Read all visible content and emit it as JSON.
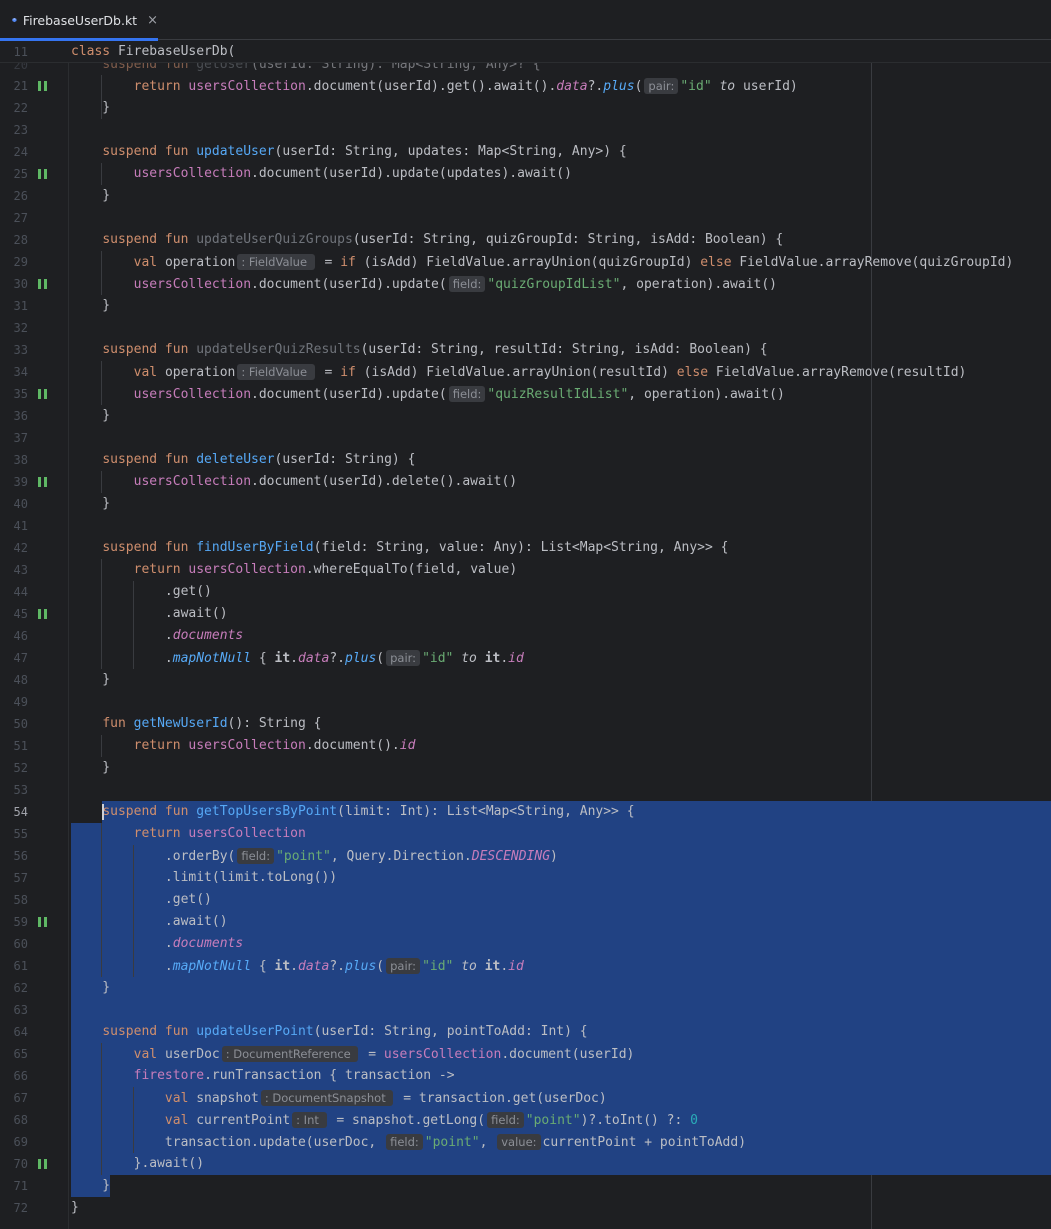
{
  "tab": {
    "filename": "FirebaseUserDb.kt",
    "close": "×"
  },
  "lines": [
    {
      "n": "11",
      "runs": [
        [
          "kw",
          "class "
        ],
        [
          "",
          "FirebaseUserDb("
        ]
      ]
    },
    {
      "n": "21",
      "g": true,
      "runs": [
        [
          "",
          "        "
        ],
        [
          "kw",
          "return "
        ],
        [
          "pr",
          "usersCollection"
        ],
        [
          "",
          ".document(userId).get().await()."
        ],
        [
          "pi",
          "data"
        ],
        [
          "",
          "?."
        ],
        [
          "ex",
          "plus"
        ],
        [
          "",
          "("
        ],
        [
          "inl",
          "pair:"
        ],
        [
          "st",
          "\"id\""
        ],
        [
          "",
          " "
        ],
        [
          "ki",
          "to"
        ],
        [
          "",
          " userId)"
        ]
      ]
    },
    {
      "n": "22",
      "runs": [
        [
          "",
          "    }"
        ]
      ]
    },
    {
      "n": "23",
      "runs": []
    },
    {
      "n": "24",
      "runs": [
        [
          "",
          "    "
        ],
        [
          "kw",
          "suspend fun "
        ],
        [
          "fn",
          "updateUser"
        ],
        [
          "",
          "(userId: String, updates: Map<String, Any>) {"
        ]
      ]
    },
    {
      "n": "25",
      "g": true,
      "runs": [
        [
          "",
          "        "
        ],
        [
          "pr",
          "usersCollection"
        ],
        [
          "",
          ".document(userId).update(updates).await()"
        ]
      ]
    },
    {
      "n": "26",
      "runs": [
        [
          "",
          "    }"
        ]
      ]
    },
    {
      "n": "27",
      "runs": []
    },
    {
      "n": "28",
      "runs": [
        [
          "",
          "    "
        ],
        [
          "kw",
          "suspend fun "
        ],
        [
          "fnu",
          "updateUserQuizGroups"
        ],
        [
          "",
          "(userId: String, quizGroupId: String, isAdd: Boolean) {"
        ]
      ]
    },
    {
      "n": "29",
      "runs": [
        [
          "",
          "        "
        ],
        [
          "kw",
          "val "
        ],
        [
          "",
          "operation"
        ],
        [
          "inl",
          ": FieldValue "
        ],
        [
          "",
          " = "
        ],
        [
          "kw",
          "if "
        ],
        [
          "",
          "(isAdd) FieldValue.arrayUnion(quizGroupId) "
        ],
        [
          "kw",
          "else "
        ],
        [
          "",
          "FieldValue.arrayRemove(quizGroupId)"
        ]
      ]
    },
    {
      "n": "30",
      "g": true,
      "runs": [
        [
          "",
          "        "
        ],
        [
          "pr",
          "usersCollection"
        ],
        [
          "",
          ".document(userId).update("
        ],
        [
          "inl",
          "field:"
        ],
        [
          "st",
          "\"quizGroupIdList\""
        ],
        [
          "",
          ", operation).await()"
        ]
      ]
    },
    {
      "n": "31",
      "runs": [
        [
          "",
          "    }"
        ]
      ]
    },
    {
      "n": "32",
      "runs": []
    },
    {
      "n": "33",
      "runs": [
        [
          "",
          "    "
        ],
        [
          "kw",
          "suspend fun "
        ],
        [
          "fnu",
          "updateUserQuizResults"
        ],
        [
          "",
          "(userId: String, resultId: String, isAdd: Boolean) {"
        ]
      ]
    },
    {
      "n": "34",
      "runs": [
        [
          "",
          "        "
        ],
        [
          "kw",
          "val "
        ],
        [
          "",
          "operation"
        ],
        [
          "inl",
          ": FieldValue "
        ],
        [
          "",
          " = "
        ],
        [
          "kw",
          "if "
        ],
        [
          "",
          "(isAdd) FieldValue.arrayUnion(resultId) "
        ],
        [
          "kw",
          "else "
        ],
        [
          "",
          "FieldValue.arrayRemove(resultId)"
        ]
      ]
    },
    {
      "n": "35",
      "g": true,
      "runs": [
        [
          "",
          "        "
        ],
        [
          "pr",
          "usersCollection"
        ],
        [
          "",
          ".document(userId).update("
        ],
        [
          "inl",
          "field:"
        ],
        [
          "st",
          "\"quizResultIdList\""
        ],
        [
          "",
          ", operation).await()"
        ]
      ]
    },
    {
      "n": "36",
      "runs": [
        [
          "",
          "    }"
        ]
      ]
    },
    {
      "n": "37",
      "runs": []
    },
    {
      "n": "38",
      "runs": [
        [
          "",
          "    "
        ],
        [
          "kw",
          "suspend fun "
        ],
        [
          "fn",
          "deleteUser"
        ],
        [
          "",
          "(userId: String) {"
        ]
      ]
    },
    {
      "n": "39",
      "g": true,
      "runs": [
        [
          "",
          "        "
        ],
        [
          "pr",
          "usersCollection"
        ],
        [
          "",
          ".document(userId).delete().await()"
        ]
      ]
    },
    {
      "n": "40",
      "runs": [
        [
          "",
          "    }"
        ]
      ]
    },
    {
      "n": "41",
      "runs": []
    },
    {
      "n": "42",
      "runs": [
        [
          "",
          "    "
        ],
        [
          "kw",
          "suspend fun "
        ],
        [
          "fn",
          "findUserByField"
        ],
        [
          "",
          "(field: String, value: Any): List<Map<String, Any>> {"
        ]
      ]
    },
    {
      "n": "43",
      "runs": [
        [
          "",
          "        "
        ],
        [
          "kw",
          "return "
        ],
        [
          "pr",
          "usersCollection"
        ],
        [
          "",
          ".whereEqualTo(field, value)"
        ]
      ]
    },
    {
      "n": "44",
      "runs": [
        [
          "",
          "            .get()"
        ]
      ]
    },
    {
      "n": "45",
      "g": true,
      "runs": [
        [
          "",
          "            .await()"
        ]
      ]
    },
    {
      "n": "46",
      "runs": [
        [
          "",
          "            ."
        ],
        [
          "pi",
          "documents"
        ]
      ]
    },
    {
      "n": "47",
      "runs": [
        [
          "",
          "            ."
        ],
        [
          "ex",
          "mapNotNull"
        ],
        [
          "",
          " { "
        ],
        [
          "it",
          "it"
        ],
        [
          "",
          "."
        ],
        [
          "pi",
          "data"
        ],
        [
          "",
          "?."
        ],
        [
          "ex",
          "plus"
        ],
        [
          "",
          "("
        ],
        [
          "inl",
          "pair:"
        ],
        [
          "st",
          "\"id\""
        ],
        [
          "",
          " "
        ],
        [
          "ki",
          "to"
        ],
        [
          "",
          " "
        ],
        [
          "it",
          "it"
        ],
        [
          "",
          "."
        ],
        [
          "pi",
          "id"
        ],
        [
          ") }"
        ]
      ]
    },
    {
      "n": "48",
      "runs": [
        [
          "",
          "    }"
        ]
      ]
    },
    {
      "n": "49",
      "runs": []
    },
    {
      "n": "50",
      "runs": [
        [
          "",
          "    "
        ],
        [
          "kw",
          "fun "
        ],
        [
          "fn",
          "getNewUserId"
        ],
        [
          "",
          "(): String {"
        ]
      ]
    },
    {
      "n": "51",
      "runs": [
        [
          "",
          "        "
        ],
        [
          "kw",
          "return "
        ],
        [
          "pr",
          "usersCollection"
        ],
        [
          "",
          ".document()."
        ],
        [
          "pi",
          "id"
        ]
      ]
    },
    {
      "n": "52",
      "runs": [
        [
          "",
          "    }"
        ]
      ]
    },
    {
      "n": "53",
      "runs": []
    },
    {
      "n": "54",
      "cur": true,
      "runs": [
        [
          "",
          "    "
        ],
        [
          "kw",
          "suspend fun "
        ],
        [
          "fn",
          "getTopUsersByPoint"
        ],
        [
          "",
          "(limit: Int): List<Map<String, Any>> {"
        ]
      ]
    },
    {
      "n": "55",
      "runs": [
        [
          "",
          "        "
        ],
        [
          "kw",
          "return "
        ],
        [
          "pr",
          "usersCollection"
        ]
      ]
    },
    {
      "n": "56",
      "runs": [
        [
          "",
          "            .orderBy("
        ],
        [
          "inl",
          "field:"
        ],
        [
          "st",
          "\"point\""
        ],
        [
          "",
          ", Query.Direction."
        ],
        [
          "pi",
          "DESCENDING"
        ],
        [
          "",
          ")"
        ]
      ]
    },
    {
      "n": "57",
      "runs": [
        [
          "",
          "            .limit(limit.toLong())"
        ]
      ]
    },
    {
      "n": "58",
      "runs": [
        [
          "",
          "            .get()"
        ]
      ]
    },
    {
      "n": "59",
      "g": true,
      "runs": [
        [
          "",
          "            .await()"
        ]
      ]
    },
    {
      "n": "60",
      "runs": [
        [
          "",
          "            ."
        ],
        [
          "pi",
          "documents"
        ]
      ]
    },
    {
      "n": "61",
      "runs": [
        [
          "",
          "            ."
        ],
        [
          "ex",
          "mapNotNull"
        ],
        [
          "",
          " { "
        ],
        [
          "it",
          "it"
        ],
        [
          "",
          "."
        ],
        [
          "pi",
          "data"
        ],
        [
          "",
          "?."
        ],
        [
          "ex",
          "plus"
        ],
        [
          "",
          "("
        ],
        [
          "inl",
          "pair:"
        ],
        [
          "st",
          "\"id\""
        ],
        [
          "",
          " "
        ],
        [
          "ki",
          "to"
        ],
        [
          "",
          " "
        ],
        [
          "it",
          "it"
        ],
        [
          "",
          "."
        ],
        [
          "pi",
          "id"
        ],
        [
          ") }"
        ]
      ]
    },
    {
      "n": "62",
      "runs": [
        [
          "",
          "    }"
        ]
      ]
    },
    {
      "n": "63",
      "runs": []
    },
    {
      "n": "64",
      "runs": [
        [
          "",
          "    "
        ],
        [
          "kw",
          "suspend fun "
        ],
        [
          "fn",
          "updateUserPoint"
        ],
        [
          "",
          "(userId: String, pointToAdd: Int) {"
        ]
      ]
    },
    {
      "n": "65",
      "runs": [
        [
          "",
          "        "
        ],
        [
          "kw",
          "val "
        ],
        [
          "",
          "userDoc"
        ],
        [
          "inl",
          ": DocumentReference "
        ],
        [
          "",
          " = "
        ],
        [
          "pr",
          "usersCollection"
        ],
        [
          "",
          ".document(userId)"
        ]
      ]
    },
    {
      "n": "66",
      "runs": [
        [
          "",
          "        "
        ],
        [
          "pr",
          "firestore"
        ],
        [
          "",
          ".runTransaction { transaction ->"
        ]
      ]
    },
    {
      "n": "67",
      "runs": [
        [
          "",
          "            "
        ],
        [
          "kw",
          "val "
        ],
        [
          "",
          "snapshot"
        ],
        [
          "inl",
          ": DocumentSnapshot "
        ],
        [
          "",
          " = transaction.get(userDoc)"
        ]
      ]
    },
    {
      "n": "68",
      "runs": [
        [
          "",
          "            "
        ],
        [
          "kw",
          "val "
        ],
        [
          "",
          "currentPoint"
        ],
        [
          "inl",
          ": Int "
        ],
        [
          "",
          " = snapshot.getLong("
        ],
        [
          "inl",
          "field:"
        ],
        [
          "st",
          "\"point\""
        ],
        [
          "",
          ")?.toInt() ?: "
        ],
        [
          "nu",
          "0"
        ]
      ]
    },
    {
      "n": "69",
      "runs": [
        [
          "",
          "            transaction.update(userDoc, "
        ],
        [
          "inl",
          "field:"
        ],
        [
          "st",
          "\"point\""
        ],
        [
          "",
          ", "
        ],
        [
          "inl",
          "value:"
        ],
        [
          "",
          "currentPoint + pointToAdd)"
        ]
      ]
    },
    {
      "n": "70",
      "g": true,
      "runs": [
        [
          "",
          "        }.await()"
        ]
      ]
    },
    {
      "n": "71",
      "runs": [
        [
          "",
          "    }"
        ]
      ]
    },
    {
      "n": "72",
      "runs": [
        [
          "",
          "}"
        ]
      ]
    }
  ],
  "partial_line": {
    "n": "20",
    "runs": [
      [
        "",
        "    "
      ],
      [
        "kw",
        "suspend fun "
      ],
      [
        "fnu",
        "getUser"
      ],
      [
        "",
        "(userId: String): Map<String, Any>? {"
      ]
    ]
  }
}
